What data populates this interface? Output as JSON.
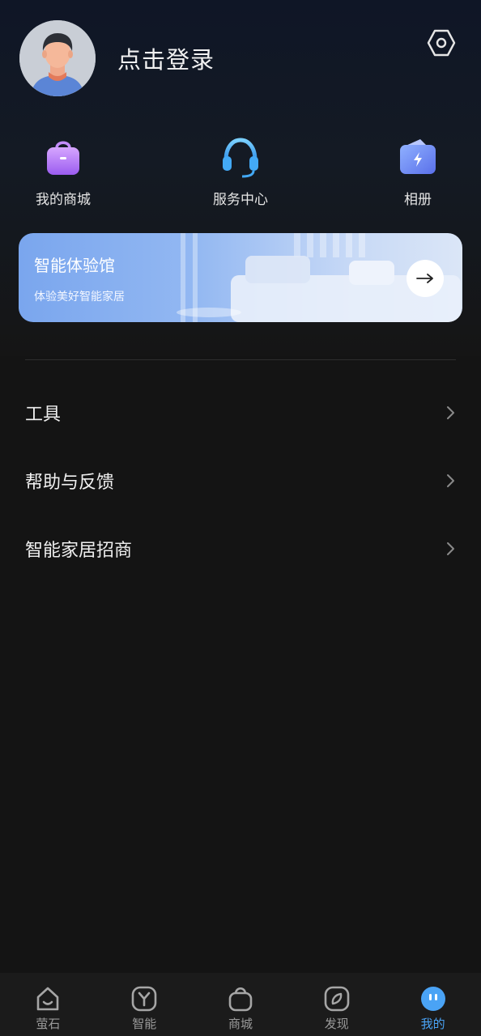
{
  "profile": {
    "login_text": "点击登录",
    "avatar_icon": "user-avatar-icon"
  },
  "header": {
    "settings_icon": "settings-hexagon-icon"
  },
  "quick_actions": [
    {
      "label": "我的商城",
      "icon": "shopping-bag-icon",
      "color": "#b57cf5"
    },
    {
      "label": "服务中心",
      "icon": "headset-icon",
      "color": "#4fb3f7"
    },
    {
      "label": "相册",
      "icon": "album-icon",
      "color": "#6a8cf3"
    }
  ],
  "banner": {
    "title": "智能体验馆",
    "subtitle": "体验美好智能家居",
    "arrow_icon": "arrow-right-icon",
    "accent": "#7aa6ee"
  },
  "menu": [
    {
      "label": "工具"
    },
    {
      "label": "帮助与反馈"
    },
    {
      "label": "智能家居招商"
    }
  ],
  "tabbar": {
    "active": "我的",
    "active_color": "#4aa3f5",
    "items": [
      {
        "label": "萤石",
        "icon": "home-face-icon"
      },
      {
        "label": "智能",
        "icon": "smart-y-icon"
      },
      {
        "label": "商城",
        "icon": "shop-bag-icon"
      },
      {
        "label": "发现",
        "icon": "compass-icon"
      },
      {
        "label": "我的",
        "icon": "profile-face-icon"
      }
    ]
  }
}
